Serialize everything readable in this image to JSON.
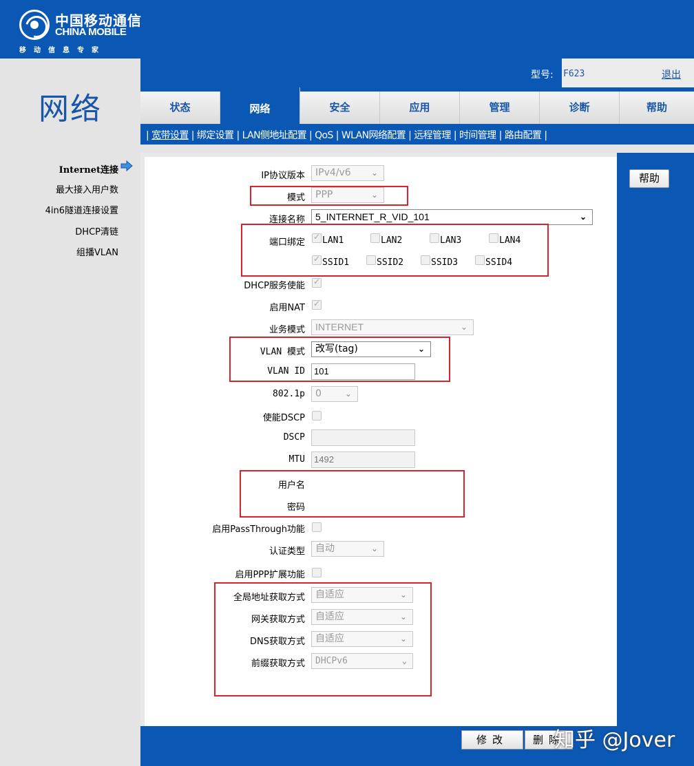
{
  "header": {
    "logo_cn": "中国移动通信",
    "logo_en": "CHINA MOBILE",
    "logo_slogan": "移动信息专家",
    "page_title": "网络",
    "model_label": "型号:",
    "model_value": "F623",
    "logout": "退出"
  },
  "tabs": [
    {
      "label": "状态",
      "active": false
    },
    {
      "label": "网络",
      "active": true
    },
    {
      "label": "安全",
      "active": false
    },
    {
      "label": "应用",
      "active": false
    },
    {
      "label": "管理",
      "active": false
    },
    {
      "label": "诊断",
      "active": false
    },
    {
      "label": "帮助",
      "active": false
    }
  ],
  "subnav": [
    "宽带设置",
    "绑定设置",
    "LAN侧地址配置",
    "QoS",
    "WLAN网络配置",
    "远程管理",
    "时间管理",
    "路由配置"
  ],
  "sidebar": {
    "items": [
      {
        "label": "Internet连接",
        "active": true
      },
      {
        "label": "最大接入用户数",
        "active": false
      },
      {
        "label": "4in6隧道连接设置",
        "active": false
      },
      {
        "label": "DHCP清链",
        "active": false
      },
      {
        "label": "组播VLAN",
        "active": false
      }
    ]
  },
  "form": {
    "ip_version": {
      "label": "IP协议版本",
      "value": "IPv4/v6"
    },
    "mode": {
      "label": "模式",
      "value": "PPP"
    },
    "conn_name": {
      "label": "连接名称",
      "value": "5_INTERNET_R_VID_101"
    },
    "port_bind": {
      "label": "端口绑定",
      "ports": [
        {
          "label": "LAN1",
          "checked": true
        },
        {
          "label": "LAN2",
          "checked": false
        },
        {
          "label": "LAN3",
          "checked": false
        },
        {
          "label": "LAN4",
          "checked": false
        },
        {
          "label": "SSID1",
          "checked": true
        },
        {
          "label": "SSID2",
          "checked": false
        },
        {
          "label": "SSID3",
          "checked": false
        },
        {
          "label": "SSID4",
          "checked": false
        }
      ]
    },
    "dhcp_server": {
      "label": "DHCP服务使能",
      "checked": true
    },
    "nat": {
      "label": "启用NAT",
      "checked": true
    },
    "service_mode": {
      "label": "业务模式",
      "value": "INTERNET"
    },
    "vlan_mode": {
      "label": "VLAN 模式",
      "value": "改写(tag)"
    },
    "vlan_id": {
      "label": "VLAN ID",
      "value": "101"
    },
    "p8021p": {
      "label": "802.1p",
      "value": "0"
    },
    "enable_dscp": {
      "label": "使能DSCP",
      "checked": false
    },
    "dscp": {
      "label": "DSCP",
      "value": ""
    },
    "mtu": {
      "label": "MTU",
      "value": "1492"
    },
    "username": {
      "label": "用户名"
    },
    "password": {
      "label": "密码"
    },
    "passthrough": {
      "label": "启用PassThrough功能",
      "checked": false
    },
    "auth_type": {
      "label": "认证类型",
      "value": "自动"
    },
    "ppp_ext": {
      "label": "启用PPP扩展功能",
      "checked": false
    },
    "global_addr": {
      "label": "全局地址获取方式",
      "value": "自适应"
    },
    "gateway": {
      "label": "网关获取方式",
      "value": "自适应"
    },
    "dns": {
      "label": "DNS获取方式",
      "value": "自适应"
    },
    "prefix": {
      "label": "前缀获取方式",
      "value": "DHCPv6"
    }
  },
  "buttons": {
    "help": "帮助",
    "modify": "修改",
    "delete": "删除"
  },
  "watermark": "知乎 @Jover",
  "colors": {
    "brand_blue": "#0a58b4",
    "annotation_red": "#d6232c"
  }
}
